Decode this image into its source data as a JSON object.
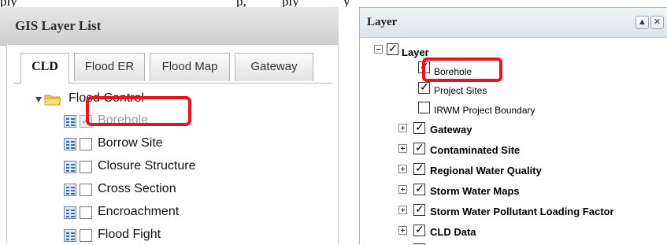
{
  "top_text": {
    "left": "ply",
    "mid": "p, ",
    "mid2": "ply",
    "right": "y"
  },
  "left_panel": {
    "title": "GIS Layer List",
    "tabs": [
      "CLD",
      "Flood ER",
      "Flood Map",
      "Gateway"
    ],
    "active_tab": "CLD",
    "root_label": "Flood Control",
    "layers": [
      {
        "label": "Borehole",
        "checked": true,
        "disabled": true
      },
      {
        "label": "Borrow Site",
        "checked": false,
        "disabled": false
      },
      {
        "label": "Closure Structure",
        "checked": false,
        "disabled": false
      },
      {
        "label": "Cross Section",
        "checked": false,
        "disabled": false
      },
      {
        "label": "Encroachment",
        "checked": false,
        "disabled": false
      },
      {
        "label": "Flood Fight",
        "checked": false,
        "disabled": false
      }
    ]
  },
  "right_panel": {
    "title": "Layer",
    "root_label": "Layer",
    "children": [
      "Borehole",
      "Project Sites",
      "IRWM Project Boundary"
    ],
    "groups": [
      "Gateway",
      "Contaminated Site",
      "Regional Water Quality",
      "Storm Water Maps",
      "Storm Water Pollutant Loading Factor",
      "CLD Data"
    ]
  },
  "colors": {
    "highlight": "#e8141c",
    "folder": "#f2c94c"
  }
}
